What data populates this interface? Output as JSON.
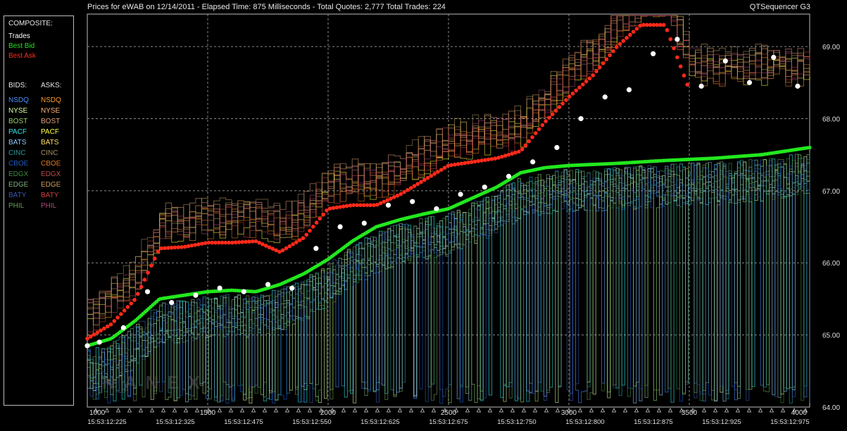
{
  "header": {
    "title": "Prices for  eWAB  on  12/14/2011  -  Elapsed Time: 875 Milliseconds  -  Total Quotes: 2,777  Total Trades: 224",
    "app_name": "QTSequencer G3"
  },
  "legend": {
    "composite_label": "COMPOSITE:",
    "composite_items": [
      {
        "label": "Trades",
        "color": "#ffffff"
      },
      {
        "label": "Best Bid",
        "color": "#22e81e"
      },
      {
        "label": "Best Ask",
        "color": "#ff2a1a"
      }
    ],
    "bids_label": "BIDS:",
    "asks_label": "ASKS:",
    "exchanges": [
      {
        "bid": "NSDQ",
        "ask": "NSDQ",
        "bid_color": "#4a90ff",
        "ask_color": "#ff9a2a"
      },
      {
        "bid": "NYSE",
        "ask": "NYSE",
        "bid_color": "#d8ffa0",
        "ask_color": "#ffb070"
      },
      {
        "bid": "BOST",
        "ask": "BOST",
        "bid_color": "#9ad26a",
        "ask_color": "#e6a07a"
      },
      {
        "bid": "PACF",
        "ask": "PACF",
        "bid_color": "#2ee8e8",
        "ask_color": "#ffff40"
      },
      {
        "bid": "BATS",
        "ask": "BATS",
        "bid_color": "#8ec8ff",
        "ask_color": "#ffe060"
      },
      {
        "bid": "CINC",
        "ask": "CINC",
        "bid_color": "#2a9a9a",
        "ask_color": "#a89060"
      },
      {
        "bid": "CBOE",
        "ask": "CBOE",
        "bid_color": "#1e5ac8",
        "ask_color": "#e07a22"
      },
      {
        "bid": "EDGX",
        "ask": "EDGX",
        "bid_color": "#3e8a3e",
        "ask_color": "#b84a4a"
      },
      {
        "bid": "EDGE",
        "ask": "EDGE",
        "bid_color": "#7fb07f",
        "ask_color": "#c8a060"
      },
      {
        "bid": "BATY",
        "ask": "BATY",
        "bid_color": "#3a5ab0",
        "ask_color": "#d04040"
      },
      {
        "bid": "PHIL",
        "ask": "PHIL",
        "bid_color": "#6a9a5a",
        "ask_color": "#a84a7a"
      }
    ]
  },
  "chart_data": {
    "type": "line",
    "title": "Prices for  eWAB  on  12/14/2011",
    "x_range": [
      1000,
      4000
    ],
    "ylim": [
      64.0,
      69.45
    ],
    "x_ticks": [
      1000,
      1500,
      2000,
      2500,
      3000,
      3500,
      4000
    ],
    "y_ticks": [
      "64.00",
      "65.00",
      "66.00",
      "67.00",
      "68.00",
      "69.00"
    ],
    "time_ticks": [
      "15:53:12:225",
      "15:53:12:325",
      "15:53:12:475",
      "15:53:12:550",
      "15:53:12:625",
      "15:53:12:675",
      "15:53:12:750",
      "15:53:12:800",
      "15:53:12:875",
      "15:53:12:925",
      "15:53:12:975"
    ],
    "grid": true,
    "series": [
      {
        "name": "Best Bid",
        "x": [
          1000,
          1100,
          1200,
          1300,
          1400,
          1500,
          1600,
          1700,
          1800,
          1900,
          2000,
          2100,
          2200,
          2300,
          2400,
          2500,
          2600,
          2700,
          2800,
          2900,
          3000,
          3200,
          3400,
          3600,
          3800,
          4000
        ],
        "values": [
          64.85,
          64.95,
          65.2,
          65.5,
          65.55,
          65.6,
          65.62,
          65.6,
          65.7,
          65.85,
          66.05,
          66.3,
          66.5,
          66.6,
          66.68,
          66.75,
          66.9,
          67.05,
          67.25,
          67.32,
          67.35,
          67.38,
          67.42,
          67.45,
          67.5,
          67.6
        ]
      },
      {
        "name": "Best Ask",
        "x": [
          1000,
          1100,
          1200,
          1300,
          1400,
          1500,
          1600,
          1700,
          1800,
          1900,
          2000,
          2100,
          2200,
          2300,
          2400,
          2500,
          2600,
          2700,
          2800,
          2900,
          3000,
          3100,
          3200,
          3300,
          3400,
          3500
        ],
        "values": [
          64.95,
          65.15,
          65.5,
          66.2,
          66.22,
          66.28,
          66.28,
          66.3,
          66.15,
          66.35,
          66.75,
          66.8,
          66.8,
          66.95,
          67.15,
          67.35,
          67.4,
          67.45,
          67.55,
          67.95,
          68.3,
          68.6,
          69.0,
          69.3,
          69.3,
          68.4
        ]
      },
      {
        "name": "Trades",
        "x": [
          1000,
          1050,
          1150,
          1250,
          1350,
          1450,
          1550,
          1650,
          1750,
          1850,
          1950,
          2050,
          2150,
          2250,
          2350,
          2450,
          2550,
          2650,
          2750,
          2850,
          2950,
          3050,
          3150,
          3250,
          3350,
          3450,
          3550,
          3650,
          3750,
          3850,
          3950
        ],
        "values": [
          64.85,
          64.9,
          65.1,
          65.6,
          65.45,
          65.55,
          65.65,
          65.6,
          65.7,
          65.65,
          66.2,
          66.5,
          66.55,
          66.8,
          66.85,
          66.75,
          66.95,
          67.05,
          67.2,
          67.4,
          67.6,
          68.0,
          68.3,
          68.4,
          68.9,
          69.1,
          68.45,
          68.8,
          68.5,
          68.85,
          68.45
        ]
      }
    ]
  },
  "watermark": "NANEX"
}
